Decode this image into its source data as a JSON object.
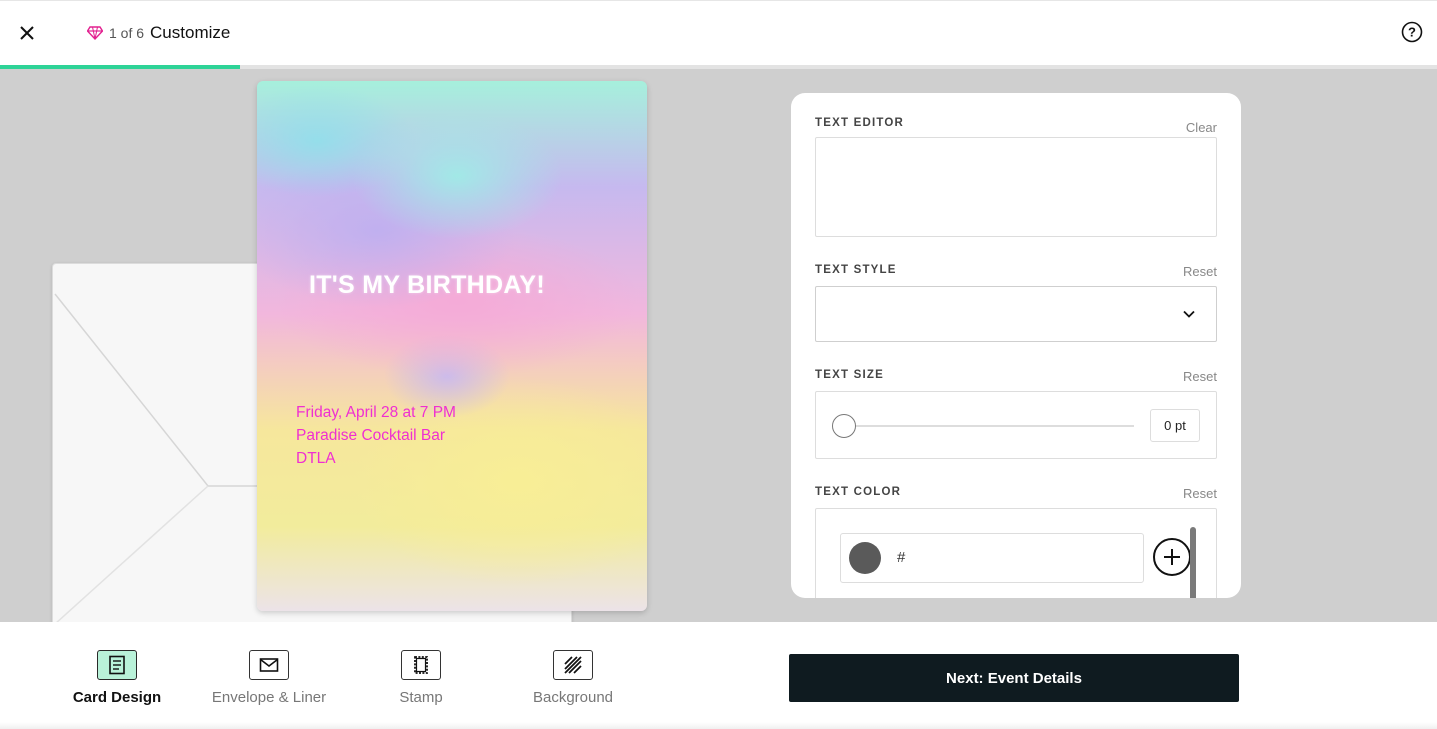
{
  "header": {
    "step_count": "1 of 6",
    "step_title": "Customize",
    "progress": 0.1667,
    "progress_color": "#2ed397"
  },
  "card": {
    "headline": "IT'S MY BIRTHDAY!",
    "details": [
      "Friday, April 28 at 7 PM",
      "Paradise Cocktail Bar",
      "DTLA"
    ],
    "detail_color": "#ef2fd1"
  },
  "panel": {
    "text_editor": {
      "label": "TEXT EDITOR",
      "action": "Clear",
      "value": ""
    },
    "text_style": {
      "label": "TEXT STYLE",
      "action": "Reset",
      "value": ""
    },
    "text_size": {
      "label": "TEXT SIZE",
      "action": "Reset",
      "value": "0 pt",
      "level": 0
    },
    "text_color": {
      "label": "TEXT COLOR",
      "action": "Reset",
      "prefix": "#",
      "swatch": "#5a5a5a"
    }
  },
  "tabs": [
    {
      "label": "Card Design",
      "icon": "card-design-icon",
      "active": true
    },
    {
      "label": "Envelope & Liner",
      "icon": "envelope-icon",
      "active": false
    },
    {
      "label": "Stamp",
      "icon": "stamp-icon",
      "active": false
    },
    {
      "label": "Background",
      "icon": "background-icon",
      "active": false
    }
  ],
  "next_button": "Next: Event Details",
  "colors": {
    "accent": "#2ed397",
    "button_dark": "#0f1b20",
    "stage_bg": "#cfcfcf"
  }
}
